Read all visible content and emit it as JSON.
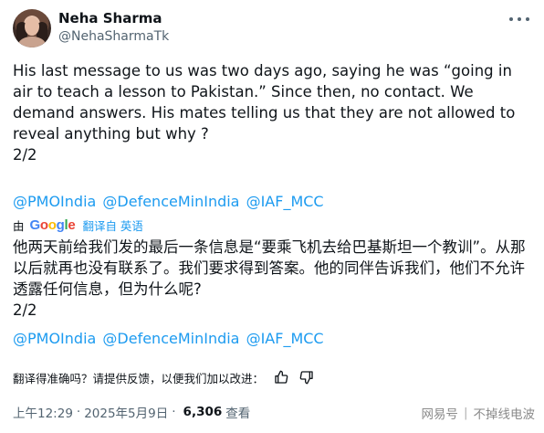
{
  "author": {
    "name": "Neha Sharma",
    "handle": "@NehaSharmaTk"
  },
  "tweet": {
    "text": "His last message to us was two days ago, saying he was “going in air to teach a lesson to Pakistan.” Since then, no contact. We demand answers. His mates telling us that they are not allowed to reveal anything but why ?\n 2/2",
    "mentions": [
      "@PMOIndia",
      "@DefenceMinIndia",
      "@IAF_MCC"
    ]
  },
  "translation_bar": {
    "prefix": "由",
    "provider": "Google",
    "link": "翻译自 英语"
  },
  "translation": {
    "text": "他两天前给我们发的最后一条信息是“要乘飞机去给巴基斯坦一个教训”。从那以后就再也没有联系了。我们要求得到答案。他的同伴告诉我们，他们不允许透露任何信息，但为什么呢?\n2/2",
    "mentions": [
      "@PMOIndia",
      "@DefenceMinIndia",
      "@IAF_MCC"
    ]
  },
  "feedback": {
    "question": "翻译得准确吗？请提供反馈，以便我们加以改进："
  },
  "meta": {
    "time": "上午12:29",
    "date": "2025年5月9日",
    "views": "6,306",
    "views_label": "查看"
  },
  "watermark": {
    "left": "网易号",
    "right": "不掉线电波"
  }
}
